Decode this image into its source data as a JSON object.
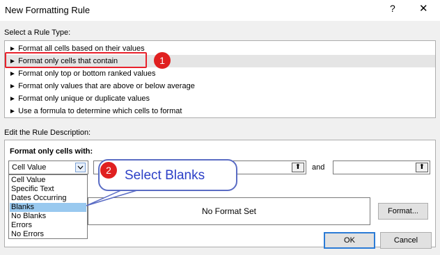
{
  "dialog": {
    "title": "New Formatting Rule",
    "help_glyph": "?",
    "close_glyph": "✕"
  },
  "rule_type": {
    "heading": "Select a Rule Type:",
    "arrow_glyph": "►",
    "items": [
      {
        "label": "Format all cells based on their values",
        "selected": false
      },
      {
        "label": "Format only cells that contain",
        "selected": true
      },
      {
        "label": "Format only top or bottom ranked values",
        "selected": false
      },
      {
        "label": "Format only values that are above or below average",
        "selected": false
      },
      {
        "label": "Format only unique or duplicate values",
        "selected": false
      },
      {
        "label": "Use a formula to determine which cells to format",
        "selected": false
      }
    ]
  },
  "description": {
    "heading": "Edit the Rule Description:",
    "format_only_label": "Format only cells with:",
    "combo_value": "Cell Value",
    "combo_arrow_icon": "chevron-down-icon",
    "dropdown_options": [
      {
        "label": "Cell Value",
        "active": false
      },
      {
        "label": "Specific Text",
        "active": false
      },
      {
        "label": "Dates Occurring",
        "active": false
      },
      {
        "label": "Blanks",
        "active": true
      },
      {
        "label": "No Blanks",
        "active": false
      },
      {
        "label": "Errors",
        "active": false
      },
      {
        "label": "No Errors",
        "active": false
      }
    ],
    "and_label": "and",
    "range_button_glyph": "⬆",
    "preview_text": "No Format Set",
    "format_button": "Format..."
  },
  "annotations": {
    "step1": "1",
    "step2": "2",
    "callout_text": "Select Blanks",
    "red": "#e02020",
    "blue": "#2b3fc7"
  },
  "footer": {
    "ok": "OK",
    "cancel": "Cancel"
  }
}
